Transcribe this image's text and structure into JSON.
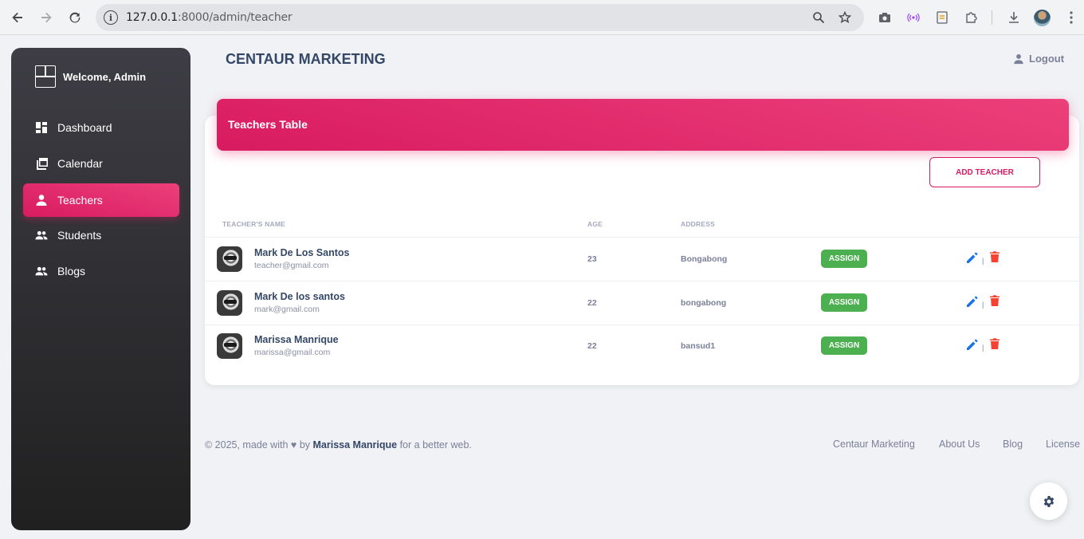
{
  "browser": {
    "url_host": "127.0.0.1",
    "url_path": ":8000/admin/teacher",
    "icons": [
      "back-icon",
      "forward-icon",
      "reload-icon",
      "site-info-icon",
      "zoom-icon",
      "bookmark-star-icon",
      "screenshot-icon",
      "broadcast-icon",
      "extension-puzzle-icon",
      "download-icon",
      "profile-avatar",
      "menu-dots-icon"
    ]
  },
  "sidebar": {
    "brand": "Welcome, Admin",
    "items": [
      {
        "label": "Dashboard",
        "icon": "dashboard-icon",
        "active": false
      },
      {
        "label": "Calendar",
        "icon": "calendar-icon",
        "active": false
      },
      {
        "label": "Teachers",
        "icon": "person-icon",
        "active": true
      },
      {
        "label": "Students",
        "icon": "group-icon",
        "active": false
      },
      {
        "label": "Blogs",
        "icon": "group-icon",
        "active": false
      }
    ]
  },
  "header": {
    "title": "CENTAUR MARKETING",
    "logout": "Logout"
  },
  "card": {
    "title": "Teachers Table",
    "add_button": "ADD TEACHER",
    "columns": [
      "TEACHER'S NAME",
      "AGE",
      "ADDRESS"
    ],
    "rows": [
      {
        "name": "Mark De Los Santos",
        "email": "teacher@gmail.com",
        "age": "23",
        "address": "Bongabong",
        "action": "ASSIGN"
      },
      {
        "name": "Mark De los santos",
        "email": "mark@gmail.com",
        "age": "22",
        "address": "bongabong",
        "action": "ASSIGN"
      },
      {
        "name": "Marissa Manrique",
        "email": "marissa@gmail.com",
        "age": "22",
        "address": "bansud1",
        "action": "ASSIGN"
      }
    ],
    "separator": "|"
  },
  "footer": {
    "prefix": "© 2025, made with",
    "by": "by",
    "author": "Marissa Manrique",
    "suffix": "for a better web.",
    "links": [
      "Centaur Marketing",
      "About Us",
      "Blog",
      "License"
    ]
  },
  "colors": {
    "accent": "#d81b60",
    "success": "#4caf50",
    "edit": "#1a73e8",
    "delete": "#f44335"
  }
}
